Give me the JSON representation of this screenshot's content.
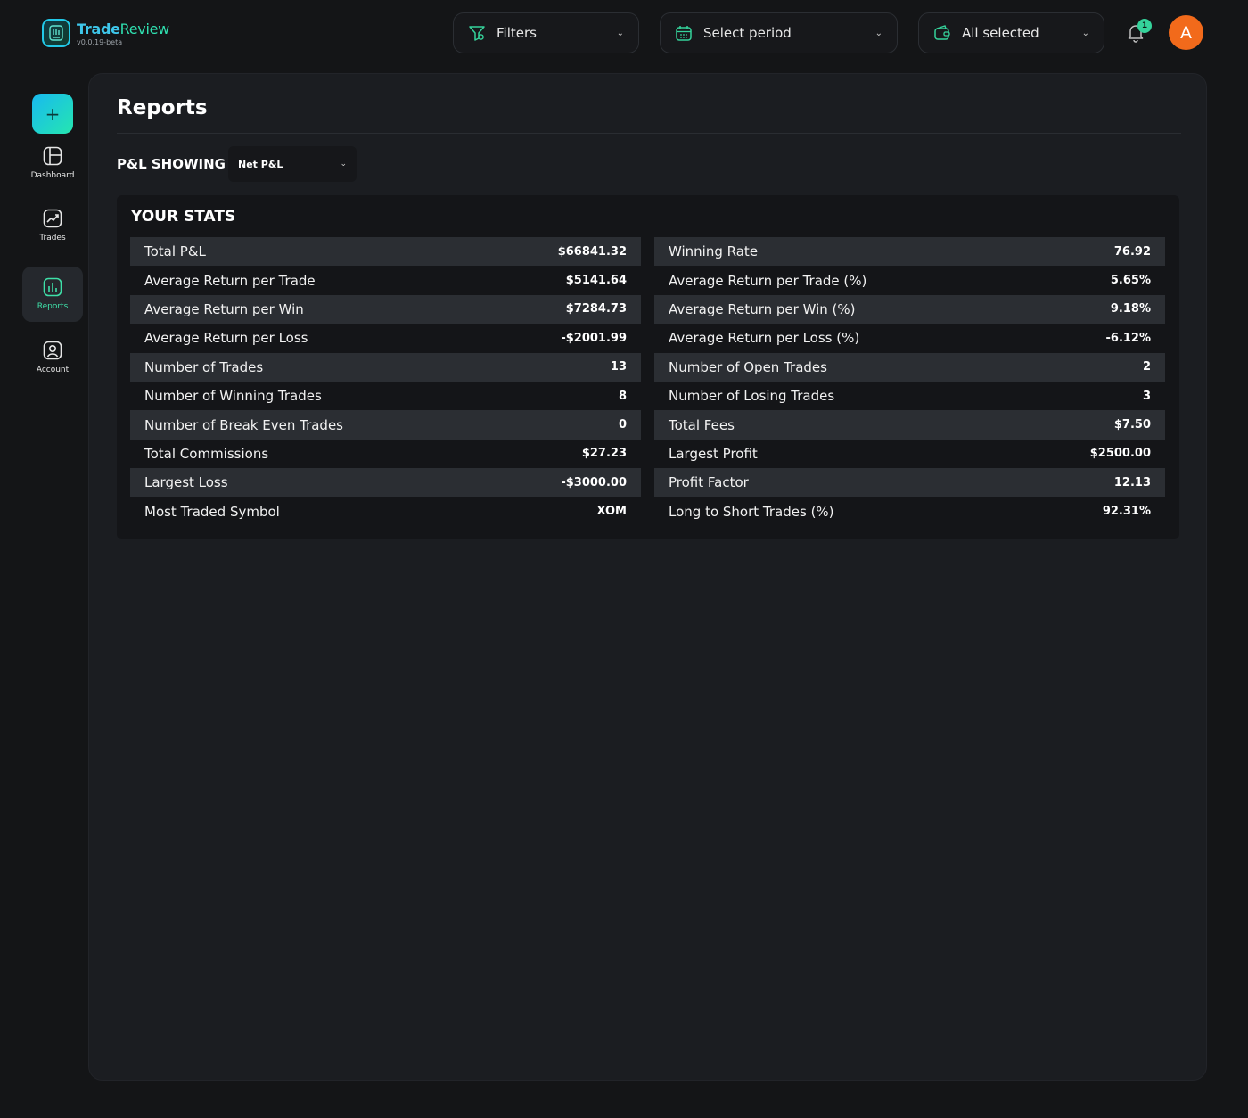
{
  "app": {
    "name_main": "Trade",
    "name_accent": "Review",
    "version": "v0.0.19-beta"
  },
  "topbar": {
    "filters_label": "Filters",
    "period_label": "Select period",
    "accounts_label": "All selected",
    "notification_count": "1",
    "avatar_initial": "A"
  },
  "sidebar": {
    "items": [
      {
        "label": "Dashboard",
        "icon": "dashboard-icon",
        "active": false
      },
      {
        "label": "Trades",
        "icon": "trades-icon",
        "active": false
      },
      {
        "label": "Reports",
        "icon": "reports-icon",
        "active": true
      },
      {
        "label": "Account",
        "icon": "account-icon",
        "active": false
      }
    ]
  },
  "page": {
    "title": "Reports",
    "pl_showing_label": "P&L SHOWING",
    "pl_select_value": "Net P&L"
  },
  "stats": {
    "title": "YOUR STATS",
    "left": [
      {
        "label": "Total P&L",
        "value": "$66841.32"
      },
      {
        "label": "Average Return per Trade",
        "value": "$5141.64"
      },
      {
        "label": "Average Return per Win",
        "value": "$7284.73"
      },
      {
        "label": "Average Return per Loss",
        "value": "-$2001.99"
      },
      {
        "label": "Number of Trades",
        "value": "13"
      },
      {
        "label": "Number of Winning Trades",
        "value": "8"
      },
      {
        "label": "Number of Break Even Trades",
        "value": "0"
      },
      {
        "label": "Total Commissions",
        "value": "$27.23"
      },
      {
        "label": "Largest Loss",
        "value": "-$3000.00"
      },
      {
        "label": "Most Traded Symbol",
        "value": "XOM"
      }
    ],
    "right": [
      {
        "label": "Winning Rate",
        "value": "76.92"
      },
      {
        "label": "Average Return per Trade (%)",
        "value": "5.65%"
      },
      {
        "label": "Average Return per Win (%)",
        "value": "9.18%"
      },
      {
        "label": "Average Return per Loss (%)",
        "value": "-6.12%"
      },
      {
        "label": "Number of Open Trades",
        "value": "2"
      },
      {
        "label": "Number of Losing Trades",
        "value": "3"
      },
      {
        "label": "Total Fees",
        "value": "$7.50"
      },
      {
        "label": "Largest Profit",
        "value": "$2500.00"
      },
      {
        "label": "Profit Factor",
        "value": "12.13"
      },
      {
        "label": "Long to Short Trades (%)",
        "value": "92.31%"
      }
    ]
  },
  "colors": {
    "background": "#141517",
    "panel": "#1b1d21",
    "accent_green": "#35d39b",
    "accent_cyan": "#22c9e8",
    "avatar": "#f26a1b"
  }
}
